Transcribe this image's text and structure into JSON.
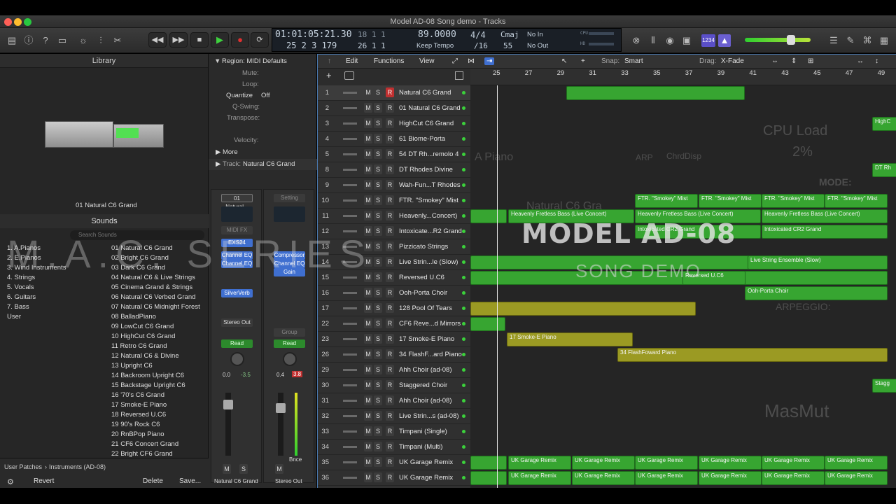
{
  "window": {
    "title": "Model AD-08 Song demo - Tracks",
    "traffic": {
      "close": "#ff5f57",
      "min": "#febc2e",
      "max": "#28c840"
    }
  },
  "toolbar": {
    "icons": [
      "library-icon",
      "info-icon",
      "help-icon",
      "toolbar-icon",
      "smart-controls-icon",
      "mixer-icon",
      "editors-icon"
    ],
    "transport": {
      "rewind": "◀◀",
      "forward": "▶▶",
      "stop": "■",
      "play": "▶",
      "record": "●",
      "cycle": "⟳"
    },
    "accent_play": "#3ed13e",
    "record_color": "#e03030"
  },
  "lcd": {
    "timecode": "01:01:05:21.30",
    "position": "25  2  3  179",
    "bars_top": "18  1  1",
    "bars_bottom": "26  1  1",
    "tempo": "89.0000",
    "tempo_mode": "Keep Tempo",
    "sig_top": "4/4",
    "sig_bottom": "/16",
    "key": "Cmaj",
    "key_num": "55",
    "in_label": "No In",
    "out_label": "No Out",
    "cpu_label": "CPU",
    "hd_label": "HD"
  },
  "library": {
    "header": "Library",
    "patch_name": "01 Natural C6 Grand",
    "sounds_label": "Sounds",
    "search_placeholder": "Search Sounds",
    "categories": [
      "1. A.Pianos",
      "2. E.Pianos",
      "3. Wind Instruments",
      "4. Strings",
      "5. Vocals",
      "6. Guitars",
      "7. Bass",
      "User"
    ],
    "sounds": [
      "01 Natural C6 Grand",
      "02 Bright C6 Grand",
      "03 Dark C6 Grand",
      "04 Natural C6 & Live Strings",
      "05 Cinema Grand & Strings",
      "06 Natural C6 Verbed Grand",
      "07 Natural C6 Midnight Forest",
      "08 BalladPiano",
      "09 LowCut C6 Grand",
      "10 HighCut C6 Grand",
      "11 Retro C6 Grand",
      "12 Natural C6 & Divine",
      "13 Upright C6",
      "14 Backroom Upright C6",
      "15 Backstage Upright C6",
      "16 '70's C6 Grand",
      "17 Smoke-E Piano",
      "18 Reversed U.C6",
      "19 90's Rock C6",
      "20 RnBPop Piano",
      "21 CF6 Concert Grand",
      "22 Bright CF6 Grand"
    ],
    "breadcrumb_1": "User Patches",
    "breadcrumb_2": "Instruments (AD-08)",
    "revert": "Revert",
    "delete": "Delete",
    "save": "Save..."
  },
  "inspector": {
    "region_label": "Region: MIDI Defaults",
    "mute": "Mute:",
    "loop": "Loop:",
    "quantize": "Quantize",
    "quantize_val": "Off",
    "qswing": "Q-Swing:",
    "transpose": "Transpose:",
    "velocity": "Velocity:",
    "more": "More",
    "track_label": "Track:",
    "track_name": "Natural C6 Grand",
    "strip1": {
      "setting": "01 Natural...",
      "eq": "EQ",
      "midi": "MIDI FX",
      "instrument": "EXS24",
      "fx1": "Channel EQ",
      "fx2": "Channel EQ",
      "send": "SilverVerb",
      "out": "Stereo Out",
      "mode": "Read",
      "pan_l": "0.0",
      "pan_r": "-3.5",
      "m": "M",
      "s": "S",
      "name": "Natural C6 Grand"
    },
    "strip2": {
      "setting": "Setting",
      "fx1": "Compressor",
      "fx2": "Channel EQ",
      "fx3": "Gain",
      "group": "Group",
      "mode": "Read",
      "pan_l": "0.4",
      "pan_r": "3.8",
      "bnce": "Bnce",
      "m": "M",
      "name": "Stereo Out"
    }
  },
  "tracks_menu": {
    "edit": "Edit",
    "functions": "Functions",
    "view": "View",
    "snap_label": "Snap:",
    "snap_value": "Smart",
    "drag_label": "Drag:",
    "drag_value": "X-Fade"
  },
  "ruler": [
    "25",
    "27",
    "29",
    "31",
    "33",
    "35",
    "37",
    "39",
    "41",
    "43",
    "45",
    "47",
    "49"
  ],
  "tracks": [
    {
      "num": "1",
      "name": "Natural C6 Grand",
      "rec": true
    },
    {
      "num": "2",
      "name": "01 Natural C6 Grand"
    },
    {
      "num": "3",
      "name": "HighCut C6 Grand"
    },
    {
      "num": "4",
      "name": "61 Biome-Porta"
    },
    {
      "num": "5",
      "name": "54 DT Rh...remolo 4"
    },
    {
      "num": "8",
      "name": "DT Rhodes Divine"
    },
    {
      "num": "9",
      "name": "Wah-Fun...T Rhodes"
    },
    {
      "num": "10",
      "name": "FTR. \"Smokey\" Mist"
    },
    {
      "num": "11",
      "name": "Heavenly...Concert)"
    },
    {
      "num": "12",
      "name": "Intoxicate...R2 Grand"
    },
    {
      "num": "13",
      "name": "Pizzicato Strings"
    },
    {
      "num": "14",
      "name": "Live Strin...le (Slow)"
    },
    {
      "num": "15",
      "name": "Reversed U.C6"
    },
    {
      "num": "16",
      "name": "Ooh-Porta Choir"
    },
    {
      "num": "17",
      "name": "128 Pool Of Tears"
    },
    {
      "num": "22",
      "name": "CF6 Reve...d Mirrors"
    },
    {
      "num": "23",
      "name": "17 Smoke-E Piano"
    },
    {
      "num": "26",
      "name": "34 FlashF...ard Piano"
    },
    {
      "num": "29",
      "name": "Ahh Choir (ad-08)"
    },
    {
      "num": "30",
      "name": "Staggered Choir"
    },
    {
      "num": "31",
      "name": "Ahh Choir (ad-08)"
    },
    {
      "num": "32",
      "name": "Live Strin...s (ad-08)"
    },
    {
      "num": "33",
      "name": "Timpani (Single)"
    },
    {
      "num": "34",
      "name": "Timpani (Multi)"
    },
    {
      "num": "35",
      "name": "UK Garage Remix"
    },
    {
      "num": "36",
      "name": "UK Garage Remix"
    }
  ],
  "regions": {
    "smokey": "FTR. \"Smokey\" Mist",
    "heavenly": "Heavenly Fretless Bass (Live Concert)",
    "intox": "Intoxicated CR2 Grand",
    "live_strings": "Live String Ensemble (Slow)",
    "reversed": "Reversed U.C6",
    "ooh": "Ooh-Porta Choir",
    "smoke_e": "17 Smoke-E Piano",
    "flash": "34 FlashFoward Piano",
    "garage": "UK Garage Remix",
    "highc": "HighC",
    "dtrh": "DT Rh",
    "stagg": "Stagg"
  },
  "overlay": {
    "title": "MODEL AD-08",
    "subtitle": "SONG DEMO",
    "series": "M.A.C. SERIES",
    "cpu_load": "CPU Load",
    "cpu_pct": "2%",
    "mode": "MODE:",
    "arpeggio": "ARPEGGIO:",
    "masmut": "MasMut",
    "arp": "ARP",
    "chrd": "ChrdDisp",
    "piano": "A Piano",
    "natural": "Natural C6 Gra"
  }
}
